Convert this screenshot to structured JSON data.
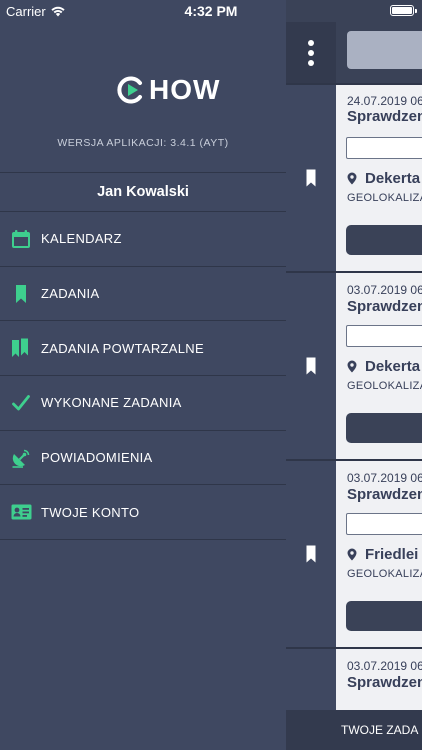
{
  "status_bar": {
    "carrier": "Carrier",
    "time": "4:32 PM"
  },
  "drawer": {
    "logo": {
      "text": "HOW",
      "mark_color": "#3ecf8e"
    },
    "version": "WERSJA APLIKACJI: 3.4.1 (AYT)",
    "user_name": "Jan Kowalski",
    "menu": [
      {
        "label": "KALENDARZ",
        "icon": "calendar-icon"
      },
      {
        "label": "ZADANIA",
        "icon": "bookmark-icon"
      },
      {
        "label": "ZADANIA POWTARZALNE",
        "icon": "double-bookmark-icon"
      },
      {
        "label": "WYKONANE ZADANIA",
        "icon": "checkmark-icon"
      },
      {
        "label": "POWIADOMIENIA",
        "icon": "satellite-dish-icon"
      },
      {
        "label": "TWOJE KONTO",
        "icon": "id-card-icon"
      }
    ]
  },
  "content": {
    "tasks": [
      {
        "date": "24.07.2019 06",
        "title": "Sprawdzen",
        "location": "Dekerta",
        "geo": "GEOLOKALIZA"
      },
      {
        "date": "03.07.2019 06",
        "title": "Sprawdzen",
        "location": "Dekerta",
        "geo": "GEOLOKALIZA"
      },
      {
        "date": "03.07.2019 06",
        "title": "Sprawdzen",
        "location": "Friedlei",
        "geo": "GEOLOKALIZA"
      },
      {
        "date": "03.07.2019 06",
        "title": "Sprawdzen"
      }
    ],
    "footer": "TWOJE ZADA"
  },
  "colors": {
    "accent": "#3ecf8e",
    "drawer_bg": "#3f4861",
    "card_bg": "#f0f1f4"
  }
}
